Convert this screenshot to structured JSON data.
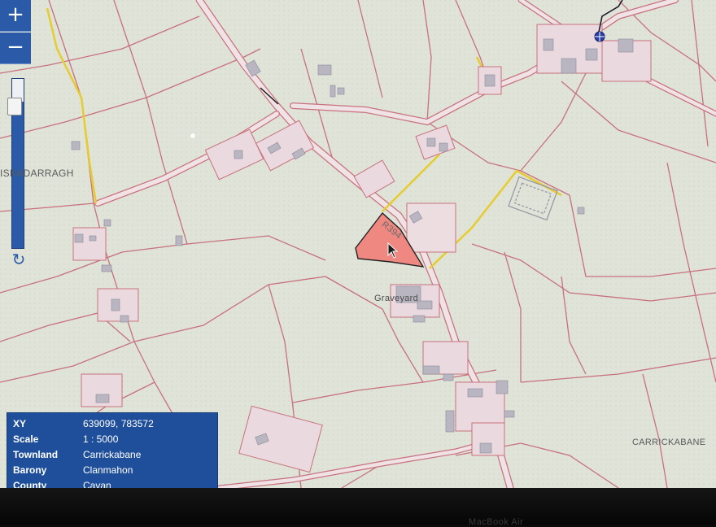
{
  "map": {
    "labels": {
      "townland_west": "ISKADARRAGH",
      "townland_east": "CARRICKABANE",
      "graveyard": "Graveyard",
      "road": "R394"
    },
    "colors": {
      "background": "#dfe3d8",
      "field_boundary": "#c8717e",
      "road_fill": "#efe3e6",
      "selected_parcel": "#ee8880",
      "building": "#b9b6c2",
      "track": "#e6cc2e",
      "control_blue": "#2b5aa8"
    }
  },
  "controls": {
    "zoom_in_label": "+",
    "zoom_out_label": "−",
    "zoom_in_icon": "plus-icon",
    "zoom_out_icon": "minus-icon",
    "refresh_icon": "refresh-icon"
  },
  "info": {
    "rows": [
      {
        "key": "XY",
        "value": "639099, 783572"
      },
      {
        "key": "Scale",
        "value": "1 : 5000"
      },
      {
        "key": "Townland",
        "value": "Carrickabane"
      },
      {
        "key": "Barony",
        "value": "Clanmahon"
      },
      {
        "key": "County",
        "value": "Cavan"
      }
    ]
  },
  "device": {
    "bezel_label": "MacBook Air"
  }
}
